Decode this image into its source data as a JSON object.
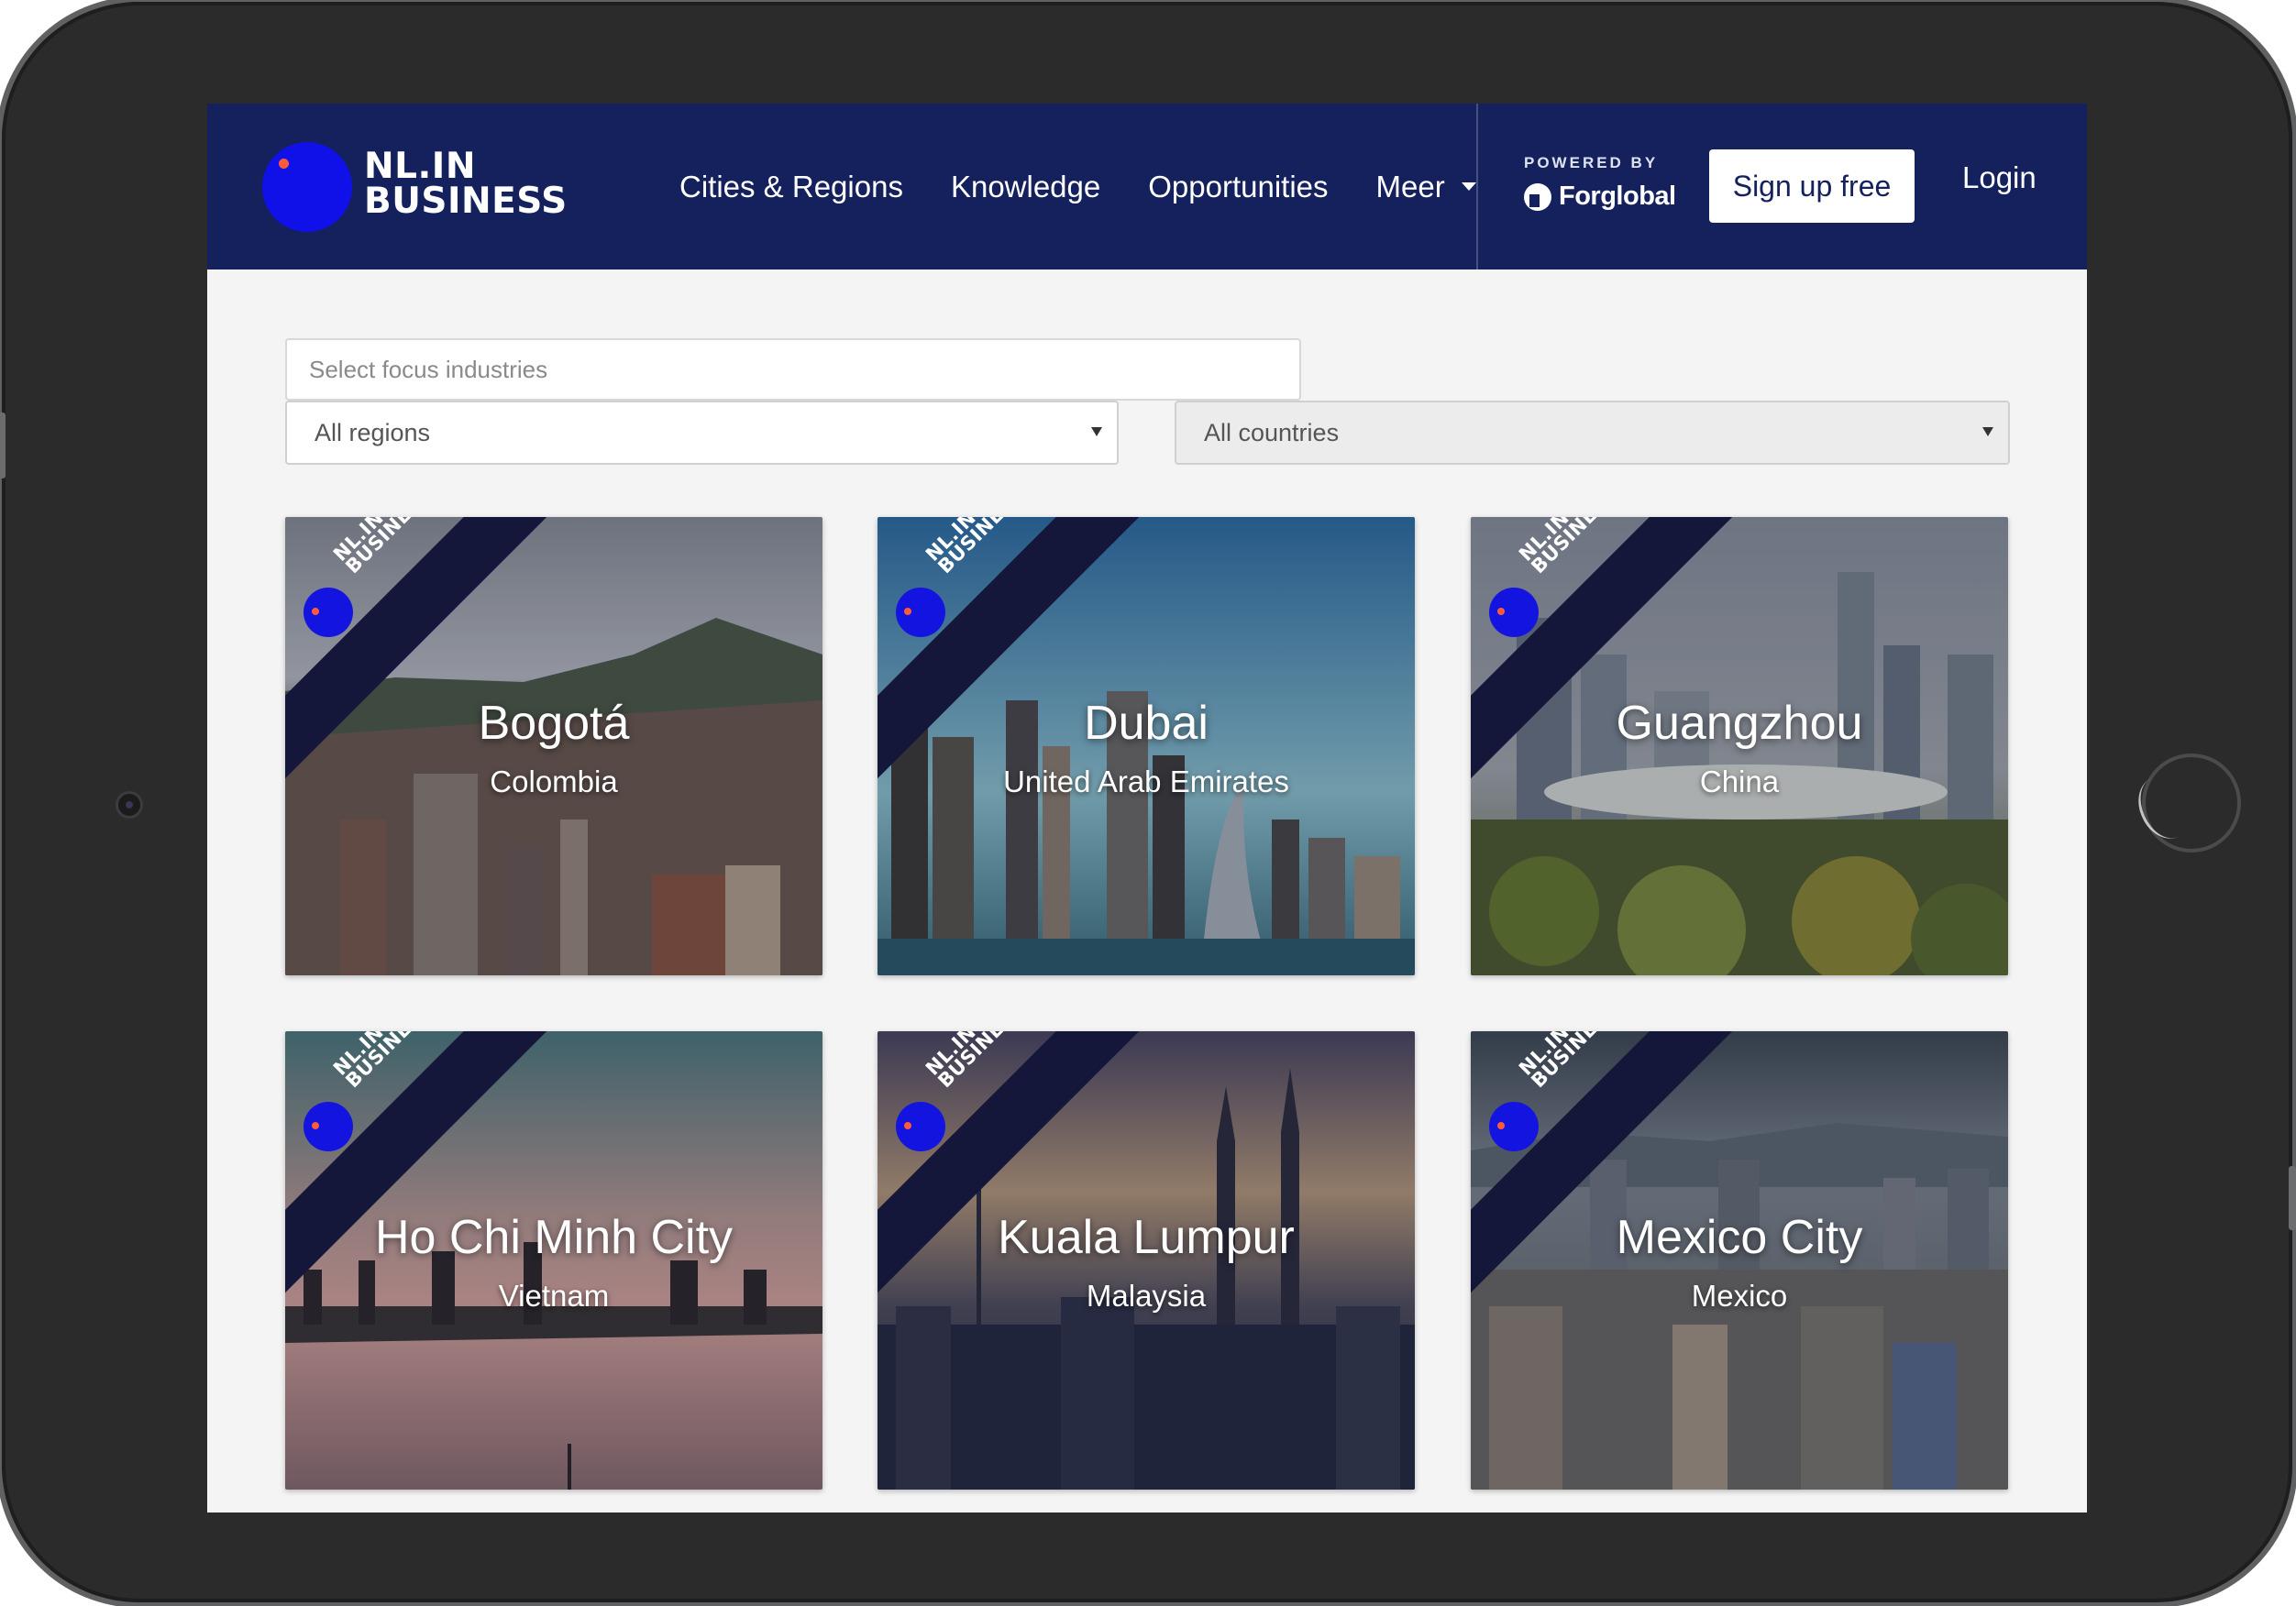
{
  "brand": {
    "logo_line1": "NL.IN",
    "logo_line2": "BUSINESS",
    "accent_color": "#1010e8",
    "navbar_color": "#15215d"
  },
  "nav": {
    "items": [
      {
        "label": "Cities & Regions"
      },
      {
        "label": "Knowledge"
      },
      {
        "label": "Opportunities"
      },
      {
        "label": "Meer"
      }
    ],
    "powered_by_label": "POWERED BY",
    "powered_by_name": "Forglobal",
    "signup_label": "Sign up free",
    "login_label": "Login"
  },
  "filters": {
    "industries_placeholder": "Select focus industries",
    "regions_selected": "All regions",
    "countries_selected": "All countries"
  },
  "cards": [
    {
      "city": "Bogotá",
      "country": "Colombia",
      "badge_line1": "NL.IN",
      "badge_line2": "BUSINESS"
    },
    {
      "city": "Dubai",
      "country": "United Arab Emirates",
      "badge_line1": "NL.IN",
      "badge_line2": "BUSINESS"
    },
    {
      "city": "Guangzhou",
      "country": "China",
      "badge_line1": "NL.IN",
      "badge_line2": "BUSINESS"
    },
    {
      "city": "Ho Chi Minh City",
      "country": "Vietnam",
      "badge_line1": "NL.IN",
      "badge_line2": "BUSINESS"
    },
    {
      "city": "Kuala Lumpur",
      "country": "Malaysia",
      "badge_line1": "NL.IN",
      "badge_line2": "BUSINESS"
    },
    {
      "city": "Mexico City",
      "country": "Mexico",
      "badge_line1": "NL.IN",
      "badge_line2": "BUSINESS"
    }
  ]
}
